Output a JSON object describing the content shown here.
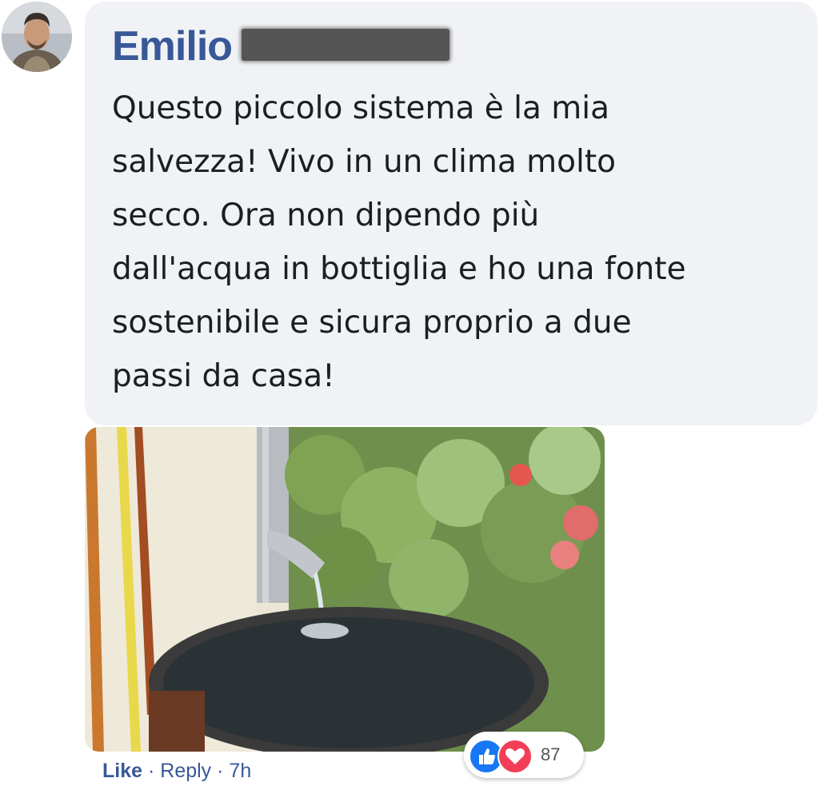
{
  "comment": {
    "author": "Emilio",
    "text": "Questo piccolo sistema è la mia\nsalvezza! Vivo in un clima molto\nsecco. Ora non dipendo più\ndall'acqua in bottiglia e ho una fonte\nsostenibile e sicura proprio a due\npassi da casa!",
    "image_icon": "rain-barrel-photo"
  },
  "reactions": {
    "icons": [
      "thumbs-up-icon",
      "heart-icon"
    ],
    "count": "87"
  },
  "actions": {
    "like": "Like",
    "separator": "·",
    "reply": "Reply",
    "time": "7h"
  },
  "colors": {
    "bubble": "#f0f2f5",
    "link": "#385898",
    "like_reaction": "#1877f2",
    "love_reaction": "#f33e58"
  }
}
